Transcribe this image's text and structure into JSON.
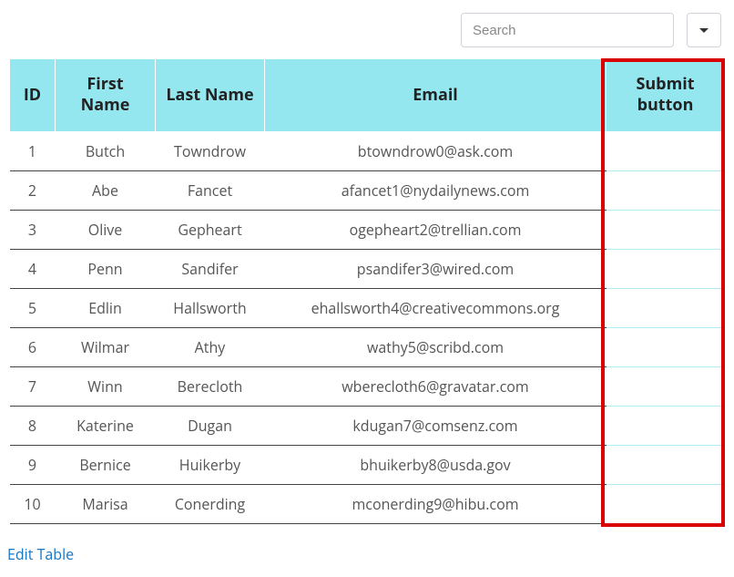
{
  "toolbar": {
    "search_placeholder": "Search"
  },
  "table": {
    "headers": {
      "id": "ID",
      "first_name": "First Name",
      "last_name": "Last Name",
      "email": "Email",
      "submit": "Submit button"
    },
    "rows": [
      {
        "id": "1",
        "first": "Butch",
        "last": "Towndrow",
        "email": "btowndrow0@ask.com"
      },
      {
        "id": "2",
        "first": "Abe",
        "last": "Fancet",
        "email": "afancet1@nydailynews.com"
      },
      {
        "id": "3",
        "first": "Olive",
        "last": "Gepheart",
        "email": "ogepheart2@trellian.com"
      },
      {
        "id": "4",
        "first": "Penn",
        "last": "Sandifer",
        "email": "psandifer3@wired.com"
      },
      {
        "id": "5",
        "first": "Edlin",
        "last": "Hallsworth",
        "email": "ehallsworth4@creativecommons.org"
      },
      {
        "id": "6",
        "first": "Wilmar",
        "last": "Athy",
        "email": "wathy5@scribd.com"
      },
      {
        "id": "7",
        "first": "Winn",
        "last": "Berecloth",
        "email": "wberecloth6@gravatar.com"
      },
      {
        "id": "8",
        "first": "Katerine",
        "last": "Dugan",
        "email": "kdugan7@comsenz.com"
      },
      {
        "id": "9",
        "first": "Bernice",
        "last": "Huikerby",
        "email": "bhuikerby8@usda.gov"
      },
      {
        "id": "10",
        "first": "Marisa",
        "last": "Conerding",
        "email": "mconerding9@hibu.com"
      }
    ]
  },
  "footer": {
    "edit_link": "Edit Table"
  }
}
